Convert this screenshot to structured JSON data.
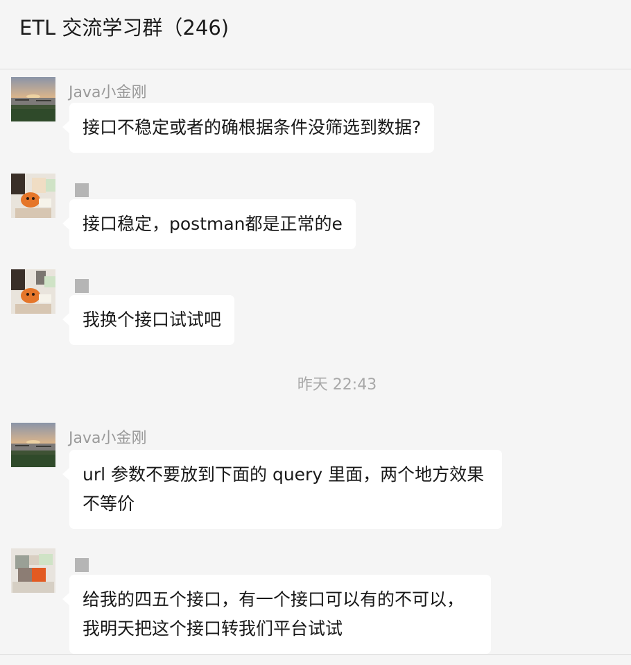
{
  "header": {
    "title": "ETL 交流学习群（246)"
  },
  "messages": [
    {
      "sender": "Java小金刚",
      "avatar": "sunset-lake-avatar",
      "text": "接口不稳定或者的确根据条件没筛选到数据?"
    },
    {
      "sender": "",
      "avatar": "cartoon-orange-avatar",
      "text": "接口稳定，postman都是正常的e"
    },
    {
      "sender": "",
      "avatar": "cartoon-orange-avatar",
      "text": "我换个接口试试吧"
    },
    {
      "sender": "Java小金刚",
      "avatar": "sunset-lake-avatar",
      "text": "url 参数不要放到下面的 query 里面，两个地方效果不等价"
    },
    {
      "sender": "",
      "avatar": "blurred-avatar",
      "text": "给我的四五个接口，有一个接口可以有的不可以，我明天把这个接口转我们平台试试"
    }
  ],
  "timestamp": "昨天 22:43",
  "colors": {
    "background": "#f5f5f5",
    "bubble": "#ffffff",
    "meta_text": "#9a9a9a"
  }
}
